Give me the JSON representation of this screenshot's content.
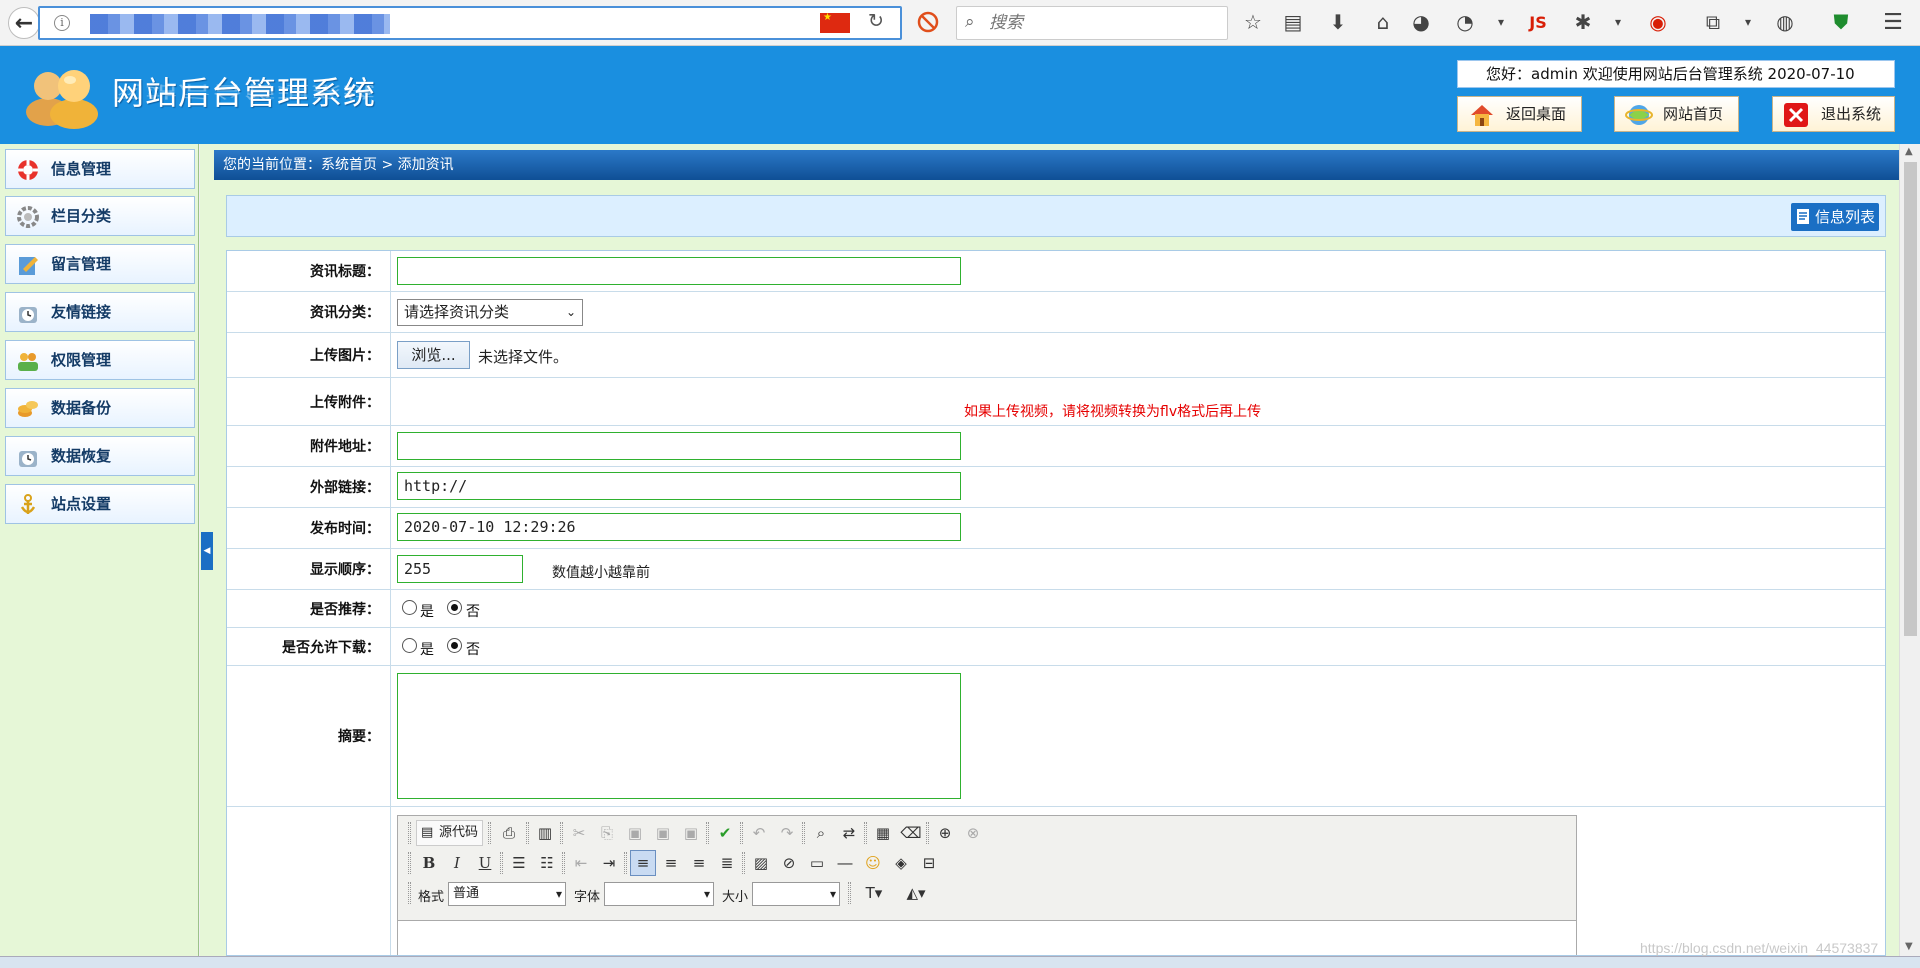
{
  "browser": {
    "search_placeholder": "搜索",
    "tool_js": "JS"
  },
  "header": {
    "title": "网站后台管理系统",
    "welcome": "您好：admin   欢迎使用网站后台管理系统   2020-07-10",
    "btn_desktop": "返回桌面",
    "btn_home": "网站首页",
    "btn_exit": "退出系统"
  },
  "sidebar": {
    "items": [
      {
        "label": "信息管理",
        "icon": "lifebuoy-icon"
      },
      {
        "label": "栏目分类",
        "icon": "gear-icon"
      },
      {
        "label": "留言管理",
        "icon": "notepad-icon"
      },
      {
        "label": "友情链接",
        "icon": "clock-icon"
      },
      {
        "label": "权限管理",
        "icon": "users-icon"
      },
      {
        "label": "数据备份",
        "icon": "coins-icon"
      },
      {
        "label": "数据恢复",
        "icon": "clock-icon"
      },
      {
        "label": "站点设置",
        "icon": "anchor-icon"
      }
    ]
  },
  "main": {
    "breadcrumb": "您的当前位置：系统首页 > 添加资讯",
    "list_button": "信息列表",
    "form": {
      "title_label": "资讯标题：",
      "title_value": "",
      "category_label": "资讯分类：",
      "category_value": "请选择资讯分类",
      "image_label": "上传图片：",
      "browse_label": "浏览...",
      "no_file": "未选择文件。",
      "attach_label": "上传附件：",
      "attach_note": "如果上传视频，请将视频转换为flv格式后再上传",
      "attach_url_label": "附件地址：",
      "attach_url_value": "",
      "ext_link_label": "外部链接：",
      "ext_link_value": "http://",
      "pub_time_label": "发布时间：",
      "pub_time_value": "2020-07-10 12:29:26",
      "order_label": "显示顺序：",
      "order_value": "255",
      "order_note": "数值越小越靠前",
      "recommend_label": "是否推荐：",
      "download_label": "是否允许下载：",
      "yes": "是",
      "no": "否",
      "summary_label": "摘要："
    },
    "editor": {
      "source_btn": "源代码",
      "format_label": "格式",
      "format_value": "普通",
      "font_label": "字体",
      "font_value": "",
      "size_label": "大小",
      "size_value": ""
    }
  },
  "watermark": "https://blog.csdn.net/weixin_44573837"
}
